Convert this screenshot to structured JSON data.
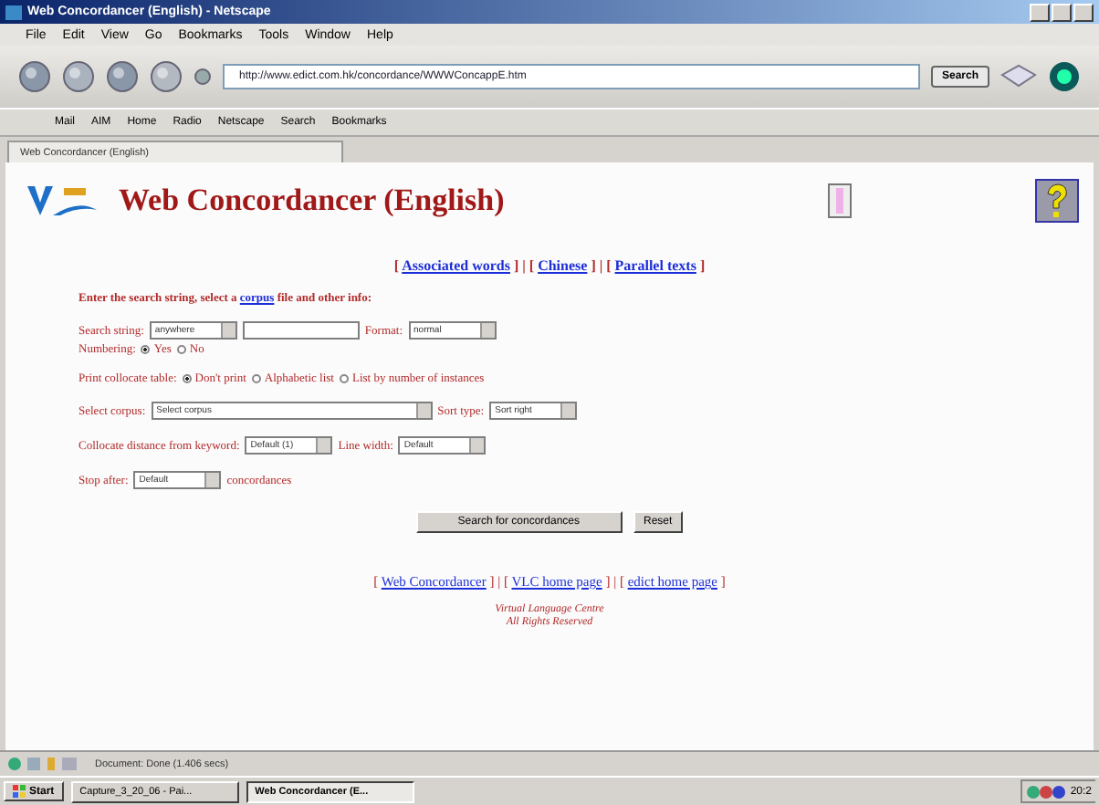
{
  "window": {
    "title": "Web Concordancer (English) - Netscape"
  },
  "menu": [
    "File",
    "Edit",
    "View",
    "Go",
    "Bookmarks",
    "Tools",
    "Window",
    "Help"
  ],
  "address": {
    "value": "http://www.edict.com.hk/concordance/WWWConcappE.htm"
  },
  "search_button": "Search",
  "personal_toolbar": [
    "Mail",
    "AIM",
    "Home",
    "Radio",
    "Netscape",
    "Search",
    "Bookmarks"
  ],
  "tabs": [
    {
      "label": "Web Concordancer (English)",
      "selected": true
    }
  ],
  "page": {
    "title": "Web Concordancer (English)",
    "top_links": [
      {
        "kind": "text",
        "text": "["
      },
      {
        "kind": "link",
        "text": "Associated words"
      },
      {
        "kind": "text",
        "text": "] | ["
      },
      {
        "kind": "link",
        "text": "Chinese"
      },
      {
        "kind": "text",
        "text": "] | ["
      },
      {
        "kind": "link",
        "text": "Parallel texts"
      },
      {
        "kind": "text",
        "text": "]"
      }
    ],
    "intro": {
      "before": "Enter the search string, select a ",
      "link": "corpus",
      "after": " file and other info:"
    },
    "sections": [
      {
        "rows": [
          [
            {
              "kind": "label",
              "text": "Search string:"
            },
            {
              "kind": "select",
              "value": "anywhere"
            },
            {
              "kind": "input"
            },
            {
              "kind": "label",
              "text": "Format:"
            },
            {
              "kind": "select",
              "value": "normal"
            }
          ],
          [
            {
              "kind": "label",
              "text": "Numbering:"
            },
            {
              "kind": "radio",
              "text": "Yes",
              "selected": true
            },
            {
              "kind": "radio",
              "text": "No",
              "selected": false
            }
          ]
        ]
      },
      {
        "rows": [
          [
            {
              "kind": "label",
              "text": "Print collocate table:"
            },
            {
              "kind": "radio",
              "text": "Don't print",
              "selected": true
            },
            {
              "kind": "radio",
              "text": "Alphabetic list",
              "selected": false
            },
            {
              "kind": "radio",
              "text": "List by number of instances",
              "selected": false
            }
          ]
        ]
      },
      {
        "rows": [
          [
            {
              "kind": "label",
              "text": "Select corpus:"
            },
            {
              "kind": "select",
              "value": "Select corpus",
              "wide": true
            },
            {
              "kind": "label",
              "text": "Sort type:"
            },
            {
              "kind": "select",
              "value": "Sort right"
            }
          ]
        ]
      },
      {
        "rows": [
          [
            {
              "kind": "label",
              "text": "Collocate distance from keyword:"
            },
            {
              "kind": "select",
              "value": "Default (1)"
            },
            {
              "kind": "label",
              "text": "Line width:"
            },
            {
              "kind": "select",
              "value": "Default"
            }
          ]
        ]
      },
      {
        "rows": [
          [
            {
              "kind": "label",
              "text": "Stop after:"
            },
            {
              "kind": "select",
              "value": "Default"
            },
            {
              "kind": "label",
              "text": "concordances"
            }
          ]
        ]
      }
    ],
    "buttons": [
      "Search for concordances",
      "Reset"
    ],
    "bottom_links": [
      {
        "kind": "text",
        "text": "["
      },
      {
        "kind": "link",
        "text": "Web Concordancer"
      },
      {
        "kind": "text",
        "text": "] | ["
      },
      {
        "kind": "link",
        "text": "VLC home page"
      },
      {
        "kind": "text",
        "text": "] | ["
      },
      {
        "kind": "link",
        "text": "edict home page"
      },
      {
        "kind": "text",
        "text": "]"
      }
    ],
    "credits": [
      "Virtual Language Centre",
      "All Rights Reserved"
    ]
  },
  "status_bar": {
    "text": "Document: Done (1.406 secs)"
  },
  "taskbar": {
    "start": "Start",
    "tasks": [
      {
        "label": "Capture_3_20_06 - Pai...",
        "selected": false
      },
      {
        "label": "Web Concordancer (E...",
        "selected": true
      }
    ],
    "clock": "20:2"
  }
}
